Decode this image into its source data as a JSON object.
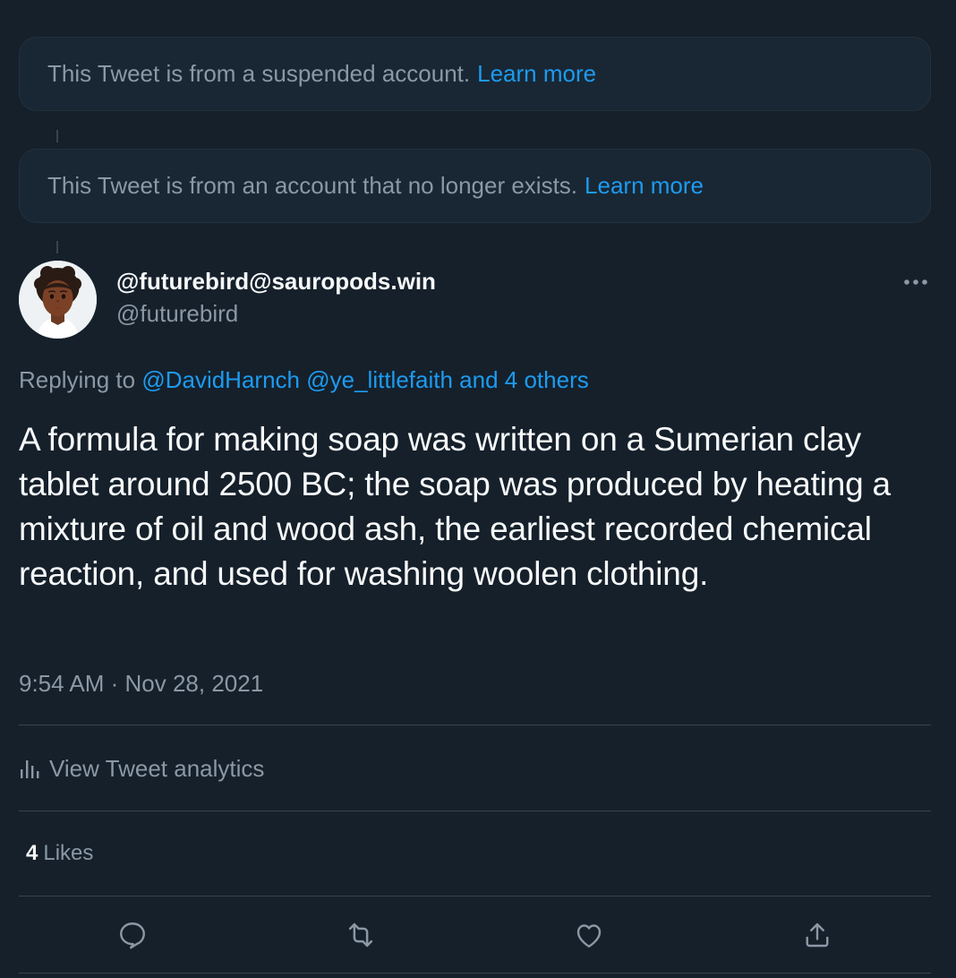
{
  "notices": [
    {
      "text": "This Tweet is from a suspended account.",
      "link": "Learn more"
    },
    {
      "text": "This Tweet is from an account that no longer exists.",
      "link": "Learn more"
    }
  ],
  "tweet": {
    "display_name": "@futurebird@sauropods.win",
    "handle": "@futurebird",
    "replying_prefix": "Replying to",
    "replying_to": [
      "@DavidHarnch",
      "@ye_littlefaith",
      "and 4 others"
    ],
    "text": "A formula for making soap was written on a Sumerian clay tablet around 2500 BC; the soap was produced by heating a mixture of oil and wood ash, the earliest recorded chemical reaction, and used for washing woolen clothing.",
    "timestamp": "9:54 AM · Nov 28, 2021",
    "analytics_label": "View Tweet analytics",
    "likes_count": "4",
    "likes_label": "Likes"
  },
  "icons": {
    "more": "more-horizontal-icon",
    "analytics": "bar-chart-icon",
    "reply": "reply-icon",
    "retweet": "retweet-icon",
    "like": "heart-icon",
    "share": "share-icon"
  },
  "colors": {
    "background": "#15202b",
    "card": "#192734",
    "accent": "#1d9bf0",
    "secondary_text": "#8b98a5",
    "divider": "#38444d"
  }
}
